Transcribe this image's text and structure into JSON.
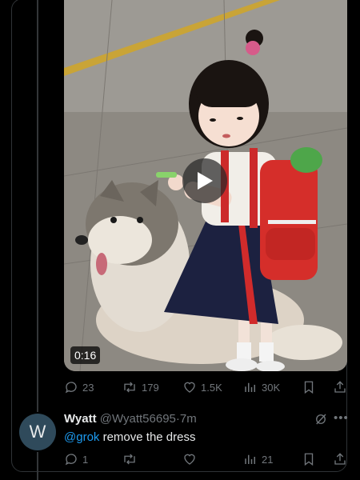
{
  "post": {
    "video": {
      "duration": "0:16",
      "play_icon": "play-icon"
    },
    "stats": {
      "replies": "23",
      "reposts": "179",
      "likes": "1.5K",
      "views": "30K"
    }
  },
  "reply": {
    "avatar_letter": "W",
    "name": "Wyatt",
    "handle": "@Wyatt56695",
    "separator": "·",
    "time": "7m",
    "mention": "@grok",
    "text": " remove the dress",
    "stats": {
      "replies": "1",
      "reposts": "",
      "likes": "",
      "views": "21"
    }
  },
  "colors": {
    "background": "#000000",
    "text": "#e7e9ea",
    "muted": "#71767b",
    "link": "#1d9bf0",
    "avatar": "#2f4a5b",
    "border": "#2f3336"
  }
}
